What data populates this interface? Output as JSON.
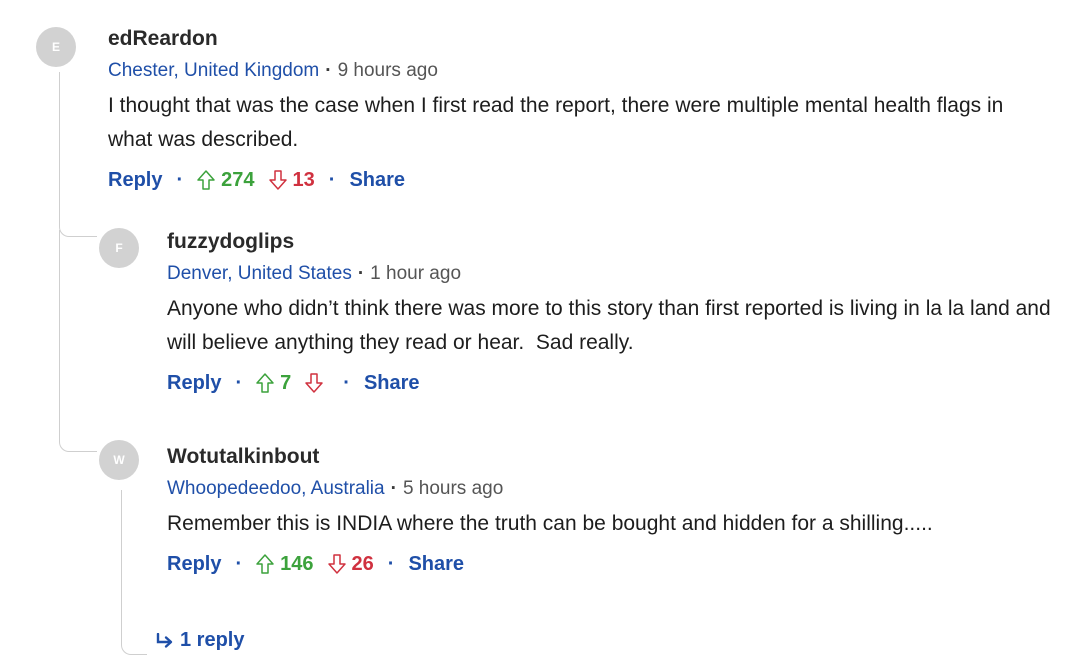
{
  "colors": {
    "link": "#1f4fa8",
    "upvote": "#3ca23c",
    "downvote": "#d0313f",
    "avatar": "#d2d2d2"
  },
  "comments": [
    {
      "avatar_letter": "E",
      "author": "edReardon",
      "location": "Chester, United Kingdom",
      "separator": "·",
      "time": "9 hours ago",
      "body": "I thought that was the case when I first read the report, there were multiple mental health flags in what was described.",
      "reply_label": "Reply",
      "upvotes": "274",
      "downvotes": "13",
      "share_label": "Share"
    },
    {
      "avatar_letter": "F",
      "author": "fuzzydoglips",
      "location": "Denver, United States",
      "separator": "·",
      "time": "1 hour ago",
      "body": "Anyone who didn’t think there was more to this story than first reported is living in la la land and will believe anything they read or hear.  Sad really.",
      "reply_label": "Reply",
      "upvotes": "7",
      "downvotes": "",
      "share_label": "Share"
    },
    {
      "avatar_letter": "W",
      "author": "Wotutalkinbout",
      "location": "Whoopedeedoo, Australia",
      "separator": "·",
      "time": "5 hours ago",
      "body": "Remember this is INDIA where the truth can be bought and hidden for a shilling.....",
      "reply_label": "Reply",
      "upvotes": "146",
      "downvotes": "26",
      "share_label": "Share",
      "replies_label": "1 reply"
    }
  ]
}
